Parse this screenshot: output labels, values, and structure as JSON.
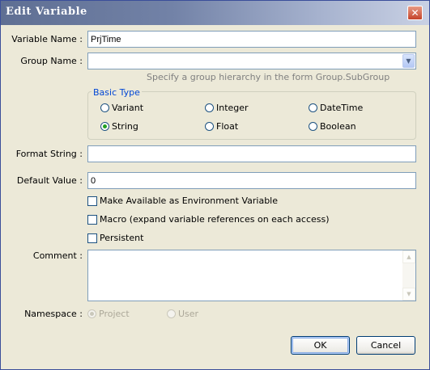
{
  "window": {
    "title": "Edit Variable",
    "close_glyph": "✕"
  },
  "form": {
    "variable_name": {
      "label": "Variable Name :",
      "value": "PrjTime"
    },
    "group_name": {
      "label": "Group Name :",
      "value": "",
      "hint": "Specify a group hierarchy in the form Group.SubGroup"
    },
    "basic_type": {
      "legend": "Basic Type",
      "options": [
        {
          "label": "Variant",
          "selected": false
        },
        {
          "label": "Integer",
          "selected": false
        },
        {
          "label": "DateTime",
          "selected": false
        },
        {
          "label": "String",
          "selected": true
        },
        {
          "label": "Float",
          "selected": false
        },
        {
          "label": "Boolean",
          "selected": false
        }
      ]
    },
    "format_string": {
      "label": "Format String :",
      "value": ""
    },
    "default_value": {
      "label": "Default Value :",
      "value": "0"
    },
    "checkboxes": [
      {
        "label": "Make Available as Environment Variable",
        "checked": false
      },
      {
        "label": "Macro (expand variable references on each access)",
        "checked": false
      },
      {
        "label": "Persistent",
        "checked": false
      }
    ],
    "comment": {
      "label": "Comment :",
      "value": ""
    },
    "namespace": {
      "label": "Namespace :",
      "options": [
        {
          "label": "Project",
          "selected": true
        },
        {
          "label": "User",
          "selected": false
        }
      ]
    }
  },
  "buttons": {
    "ok": "OK",
    "cancel": "Cancel"
  },
  "colors": {
    "title_text": "#ffffff",
    "group_legend": "#0046d5",
    "hint_text": "#808080",
    "radio_selected": "#21a121"
  }
}
